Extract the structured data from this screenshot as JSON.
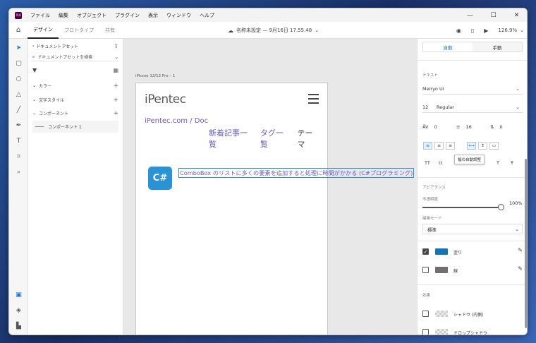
{
  "app": {
    "logo": "Xd"
  },
  "menu": [
    "ファイル",
    "編集",
    "オブジェクト",
    "プラグイン",
    "表示",
    "ウィンドウ",
    "ヘルプ"
  ],
  "window_controls": {
    "min": "—",
    "max": "☐",
    "close": "✕"
  },
  "toolbar": {
    "tabs": [
      "デザイン",
      "プロトタイプ",
      "共有"
    ],
    "doc_title": "名称未設定 — 9月16日 17.55.48",
    "zoom": "126.9%"
  },
  "assets": {
    "title": "ドキュメントアセット",
    "search_placeholder": "ドキュメントアセットを検索",
    "colors": "カラー",
    "charstyles": "文字スタイル",
    "components": "コンポーネント",
    "component_item": "コンポーネント 1"
  },
  "canvas": {
    "artboard_label": "iPhone 12/12 Pro – 1",
    "logo": "iPentec",
    "breadcrumb": "iPentec.com  /  Doc",
    "nav": [
      "新着記事一覧",
      "タグ一覧",
      "テーマ"
    ],
    "badge": "C#",
    "link": "ComboBox のリストに多くの要素を追加すると処理に時間がかかる (C#プログラミング)"
  },
  "props": {
    "mode_auto": "自動",
    "mode_manual": "手動",
    "text_section": "テキスト",
    "font": "Meiryo UI",
    "size": "12",
    "weight": "Regular",
    "char_spacing": "0",
    "line_spacing": "16",
    "para_spacing": "0",
    "tooltip": "幅の自動調整",
    "appearance": "アピアランス",
    "opacity_label": "不透明度",
    "opacity": "100%",
    "blend_label": "描画モード",
    "blend": "標準",
    "fill_label": "塗り",
    "stroke_label": "線",
    "effects": "効果",
    "inner_shadow": "シャドウ (内側)",
    "drop_shadow": "ドロップシャドウ",
    "fill_color": "#1276b4",
    "stroke_color": "#707070"
  }
}
